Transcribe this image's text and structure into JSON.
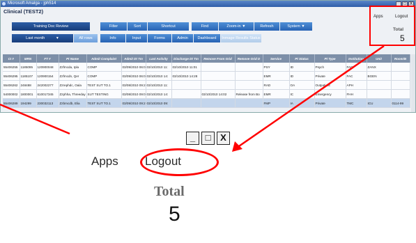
{
  "window": {
    "title": "Microsoft Amalga - jph514",
    "controls": [
      "_",
      "□",
      "X"
    ]
  },
  "app": {
    "clinic_title": "Clinical (TEST2)"
  },
  "toolbar": {
    "training": "Training Doc Review",
    "period": "Last month",
    "period_arrow": "▼",
    "all_rows": "All rows",
    "filter": "Filter",
    "sort": "Sort",
    "shortcut": "Shortcut",
    "find": "Find",
    "zoom": "Zoom-in ▼",
    "refresh": "Refresh",
    "system": "System ▼"
  },
  "tabs": [
    "Info",
    "Input",
    "Forms",
    "Admin",
    "Dashboard",
    "Inmage Results Status"
  ],
  "corner": {
    "apps": "Apps",
    "logout": "Logout",
    "total_label": "Total",
    "total_value": "5"
  },
  "table": {
    "columns": [
      "CI #",
      "MRN",
      "FT #",
      "Pt Name",
      "Admit Complaint",
      "Admit Dt Tm",
      "Last Activity",
      "Discharge Dt Tm",
      "Remove From Grid",
      "Remove Grid D",
      "Service",
      "Pt Status",
      "Pt Type",
      "Institution",
      "Unit",
      "Room/B"
    ],
    "rows": [
      [
        "55406255",
        "1185095",
        "120900048",
        "Zzfmcda, Ipla",
        "COMP",
        "03/09/2010 06:00",
        "03/10/2010 11:",
        "03/10/2010 11:01",
        "",
        "",
        "PSY",
        "ID",
        "Psych",
        "FAC",
        "ZANX",
        ""
      ],
      [
        "55406295",
        "1185107",
        "120900154",
        "Zzfmcdn, Qer",
        "COMP",
        "03/09/2010 06:00",
        "03/10/2010 14:",
        "03/10/2010 14:28",
        "",
        "",
        "EMR",
        "ID",
        "Private",
        "FAC",
        "BGEN",
        ""
      ],
      [
        "55406262",
        "248488",
        "242002277",
        "Zzrephdc, Oala",
        "TEST SUT TO.1",
        "03/08/2010 09:26",
        "03/10/2010 11:",
        "",
        "",
        "",
        "RAD",
        "OA",
        "Outpatient",
        "APH",
        "",
        ""
      ],
      [
        "54000002",
        "1800001",
        "610017345",
        "Zzphha, Threeday",
        "SUT TESTING",
        "03/08/2010 09:09",
        "03/10/2010 14:",
        "",
        "03/10/2010 14:02",
        "Release from Bo",
        "EMR",
        "IC",
        "Emergency",
        "FHH",
        "",
        ""
      ],
      [
        "55406289",
        "194299",
        "230032113",
        "Zzbmcdb, Elia",
        "TEST SUT TO.1",
        "03/09/2010 09:28",
        "03/10/2010 09:",
        "",
        "",
        "",
        "FMP",
        "IA",
        "Private",
        "TMC",
        "ICU",
        "0114-99"
      ]
    ]
  },
  "colors": {
    "accent_red": "#ff0000",
    "button_blue": "#2763b4",
    "header_gray": "#7d8fa8"
  }
}
